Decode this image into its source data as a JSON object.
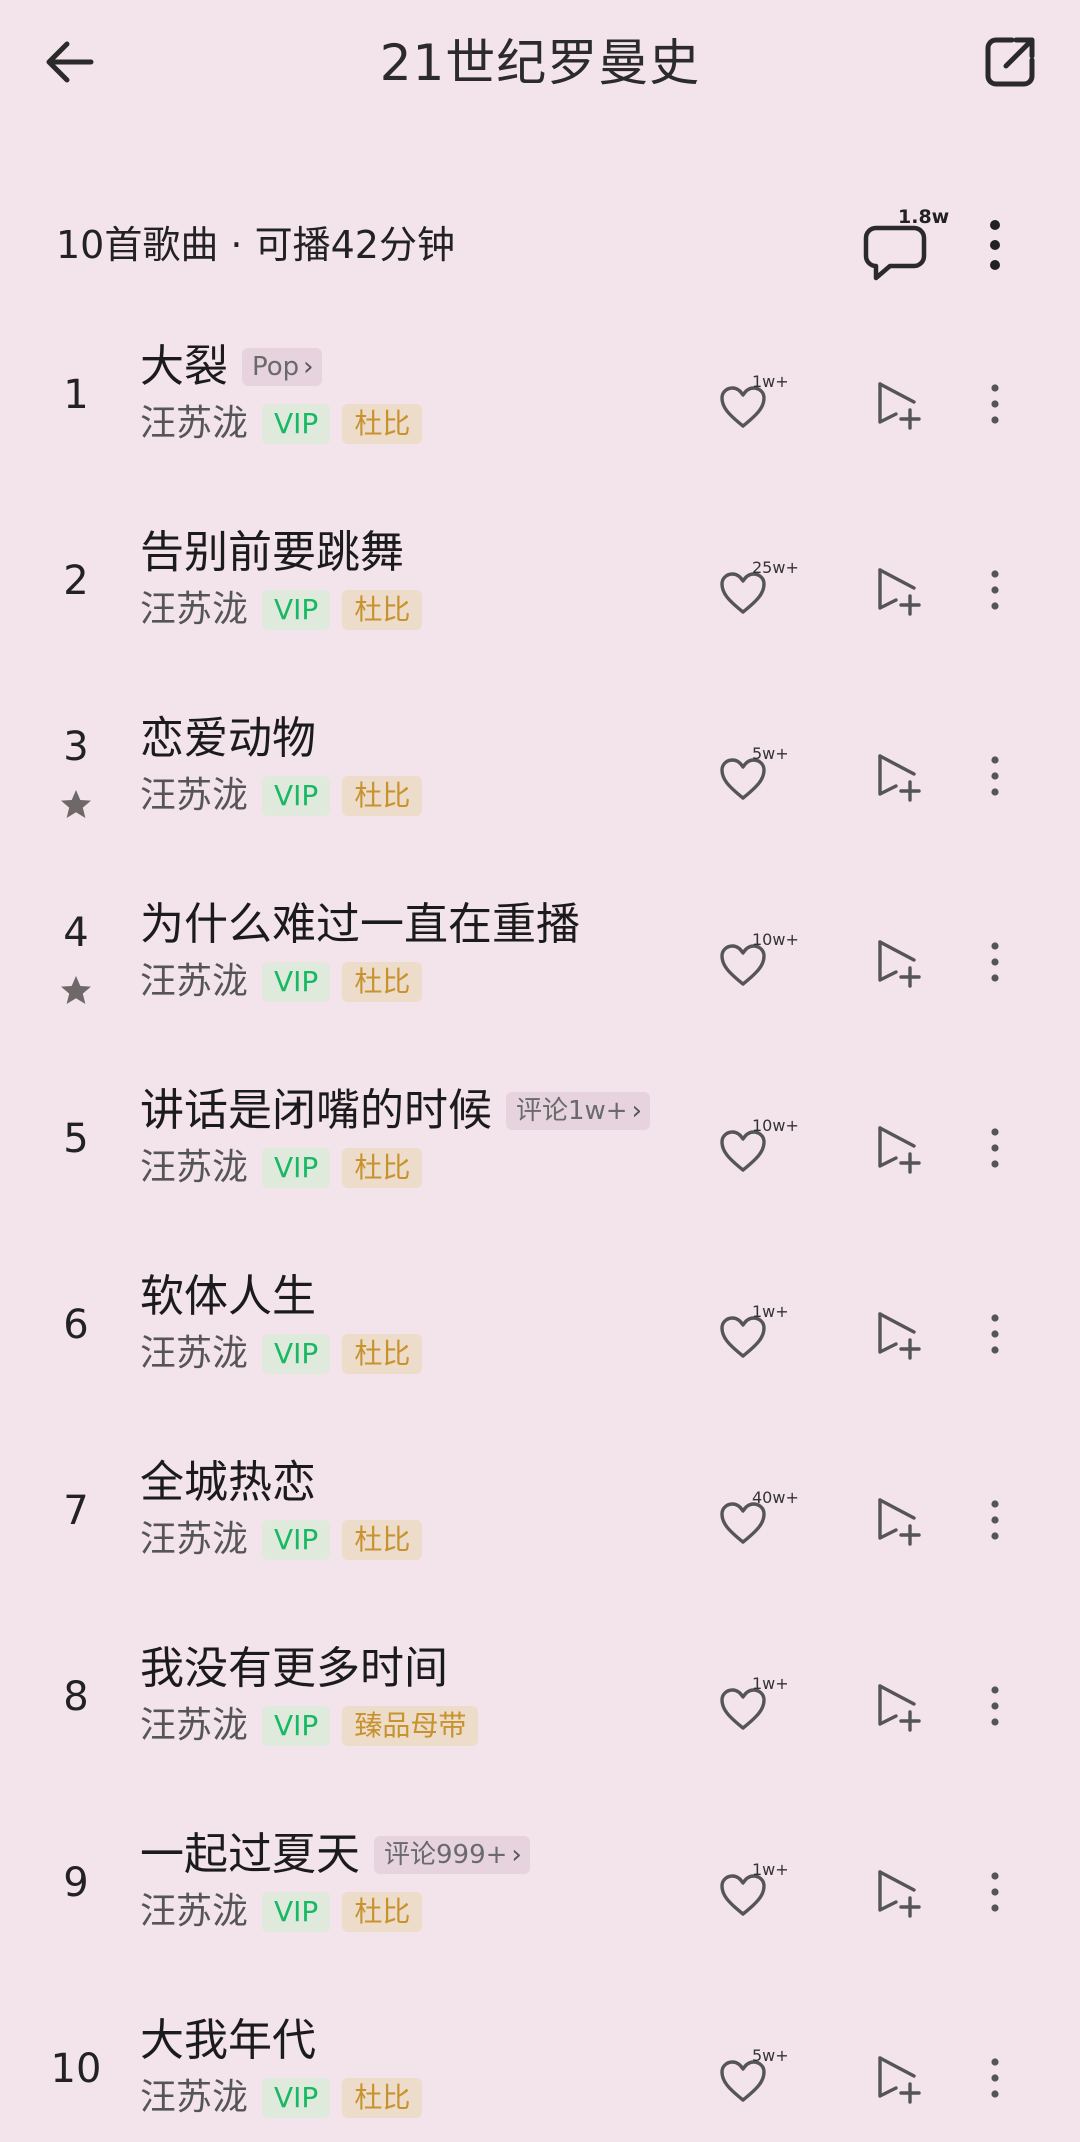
{
  "header": {
    "title": "21世纪罗曼史",
    "back_icon": "back-arrow-icon",
    "share_icon": "share-icon"
  },
  "summary": {
    "text": "10首歌曲 · 可播42分钟",
    "comment_count": "1.8w",
    "comment_icon": "comment-bubble-icon"
  },
  "songs": [
    {
      "num": "1",
      "title": "大裂",
      "tag": "Pop",
      "artist": "汪苏泷",
      "vip": "VIP",
      "badge": "杜比",
      "likes": "1w+",
      "starred": false
    },
    {
      "num": "2",
      "title": "告别前要跳舞",
      "tag": "",
      "artist": "汪苏泷",
      "vip": "VIP",
      "badge": "杜比",
      "likes": "25w+",
      "starred": false
    },
    {
      "num": "3",
      "title": "恋爱动物",
      "tag": "",
      "artist": "汪苏泷",
      "vip": "VIP",
      "badge": "杜比",
      "likes": "5w+",
      "starred": true
    },
    {
      "num": "4",
      "title": "为什么难过一直在重播",
      "tag": "",
      "artist": "汪苏泷",
      "vip": "VIP",
      "badge": "杜比",
      "likes": "10w+",
      "starred": true
    },
    {
      "num": "5",
      "title": "讲话是闭嘴的时候",
      "tag": "评论1w+",
      "artist": "汪苏泷",
      "vip": "VIP",
      "badge": "杜比",
      "likes": "10w+",
      "starred": false
    },
    {
      "num": "6",
      "title": "软体人生",
      "tag": "",
      "artist": "汪苏泷",
      "vip": "VIP",
      "badge": "杜比",
      "likes": "1w+",
      "starred": false
    },
    {
      "num": "7",
      "title": "全城热恋",
      "tag": "",
      "artist": "汪苏泷",
      "vip": "VIP",
      "badge": "杜比",
      "likes": "40w+",
      "starred": false
    },
    {
      "num": "8",
      "title": "我没有更多时间",
      "tag": "",
      "artist": "汪苏泷",
      "vip": "VIP",
      "badge": "臻品母带",
      "likes": "1w+",
      "starred": false
    },
    {
      "num": "9",
      "title": "一起过夏天",
      "tag": "评论999+",
      "artist": "汪苏泷",
      "vip": "VIP",
      "badge": "杜比",
      "likes": "1w+",
      "starred": false
    },
    {
      "num": "10",
      "title": "大我年代",
      "tag": "",
      "artist": "汪苏泷",
      "vip": "VIP",
      "badge": "杜比",
      "likes": "5w+",
      "starred": false
    }
  ],
  "colors": {
    "background": "#f3e3eb",
    "vip_green": "#18b865",
    "badge_gold": "#c8922f"
  }
}
